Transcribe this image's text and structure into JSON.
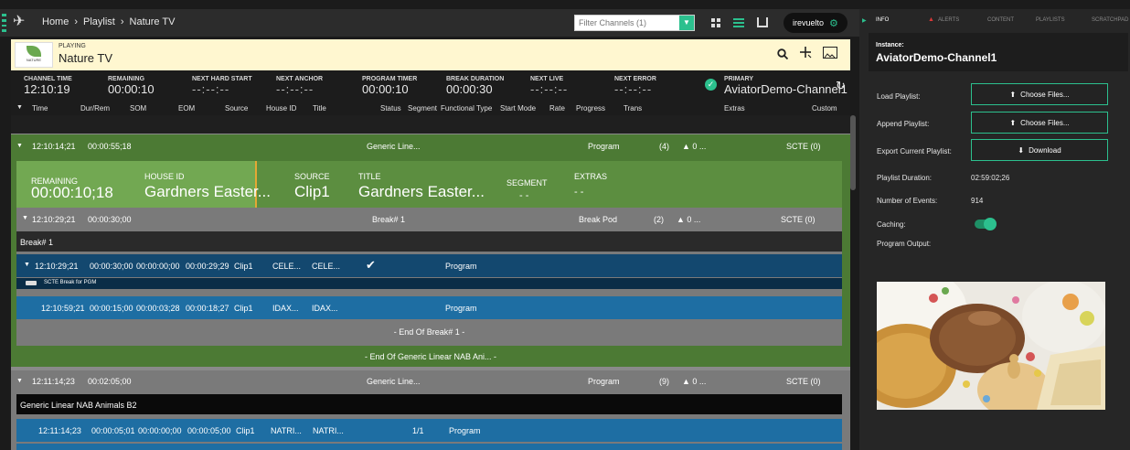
{
  "topbar": {
    "home": "Home",
    "crumb1": "Playlist",
    "crumb2": "Nature TV",
    "filter_placeholder": "Filter Channels (1)",
    "user": "irevuelto"
  },
  "channel": {
    "playing_label": "PLAYING",
    "name": "Nature TV",
    "logo_text": "NATURE"
  },
  "stats": {
    "channel_time_label": "CHANNEL TIME",
    "channel_time": "12:10:19",
    "remaining_label": "REMAINING",
    "remaining": "00:00:10",
    "next_hard_start_label": "NEXT HARD START",
    "next_hard_start": "--:--:--",
    "next_anchor_label": "NEXT ANCHOR",
    "next_anchor": "--:--:--",
    "program_timer_label": "PROGRAM TIMER",
    "program_timer": "00:00:10",
    "break_duration_label": "BREAK DURATION",
    "break_duration": "00:00:30",
    "next_live_label": "NEXT LIVE",
    "next_live": "--:--:--",
    "next_error_label": "NEXT ERROR",
    "next_error": "--:--:--",
    "primary_label": "PRIMARY",
    "primary": "AviatorDemo-Channel1"
  },
  "columns": [
    "Time",
    "Dur/Rem",
    "SOM",
    "EOM",
    "Source",
    "House ID",
    "Title",
    "Status",
    "Segment",
    "Functional Type",
    "Start Mode",
    "Rate",
    "Progress",
    "Trans",
    "Extras",
    "Custom"
  ],
  "rows": {
    "g1": {
      "time": "12:10:14;21",
      "dur": "00:00:55;18",
      "title": "Generic Line...",
      "type": "Program",
      "count": "(4)",
      "warn": "▲ 0 ...",
      "scte": "SCTE (0)"
    },
    "current": {
      "remaining_label": "REMAINING",
      "remaining": "00:00:10;18",
      "house_label": "HOUSE ID",
      "house": "Gardners Easter...",
      "source_label": "SOURCE",
      "source": "Clip1",
      "title_label": "TITLE",
      "title": "Gardners Easter...",
      "segment_label": "SEGMENT",
      "segment": "- -",
      "extras_label": "EXTRAS",
      "extras": "- -"
    },
    "b1": {
      "time": "12:10:29;21",
      "dur": "00:00:30;00",
      "title": "Break# 1",
      "type": "Break Pod",
      "count": "(2)",
      "warn": "▲ 0 ...",
      "scte": "SCTE (0)"
    },
    "b1_name": "Break# 1",
    "e1": {
      "time": "12:10:29;21",
      "dur": "00:00:30;00",
      "som": "00:00:00;00",
      "eom": "00:00:29;29",
      "source": "Clip1",
      "house": "CELE...",
      "title": "CELE...",
      "type": "Program"
    },
    "e1_scte": "SCTE Break for PGM",
    "e2": {
      "time": "12:10:59;21",
      "dur": "00:00:15;00",
      "som": "00:00:03;28",
      "eom": "00:00:18;27",
      "source": "Clip1",
      "house": "IDAX...",
      "title": "IDAX...",
      "type": "Program"
    },
    "end_break": "- End Of Break# 1 -",
    "end_generic": "- End Of Generic Linear NAB Ani... -",
    "g2": {
      "time": "12:11:14;23",
      "dur": "00:02:05;00",
      "title": "Generic Line...",
      "type": "Program",
      "count": "(9)",
      "warn": "▲ 0 ...",
      "scte": "SCTE (0)"
    },
    "g2_name": "Generic Linear NAB Animals B2",
    "e3": {
      "time": "12:11:14;23",
      "dur": "00:00:05;01",
      "som": "00:00:00;00",
      "eom": "00:00:05;00",
      "source": "Clip1",
      "house": "NATRI...",
      "title": "NATRI...",
      "segment": "1/1",
      "type": "Program"
    }
  },
  "right": {
    "tabs": [
      "INFO",
      "ALERTS",
      "CONTENT",
      "PLAYLISTS",
      "SCRATCHPAD"
    ],
    "instance_label": "Instance:",
    "instance": "AviatorDemo-Channel1",
    "load_label": "Load Playlist:",
    "append_label": "Append Playlist:",
    "export_label": "Export Current Playlist:",
    "choose_files": "Choose Files...",
    "download": "Download",
    "duration_label": "Playlist Duration:",
    "duration": "02:59:02;26",
    "events_label": "Number of Events:",
    "events": "914",
    "caching_label": "Caching:",
    "output_label": "Program Output:"
  },
  "colors": {
    "accent": "#2cc08e",
    "green_row": "#4c7a34",
    "blue_row": "#1e6ea3",
    "gray_row": "#7a7a7a",
    "chan_bg": "#fff7d0"
  }
}
